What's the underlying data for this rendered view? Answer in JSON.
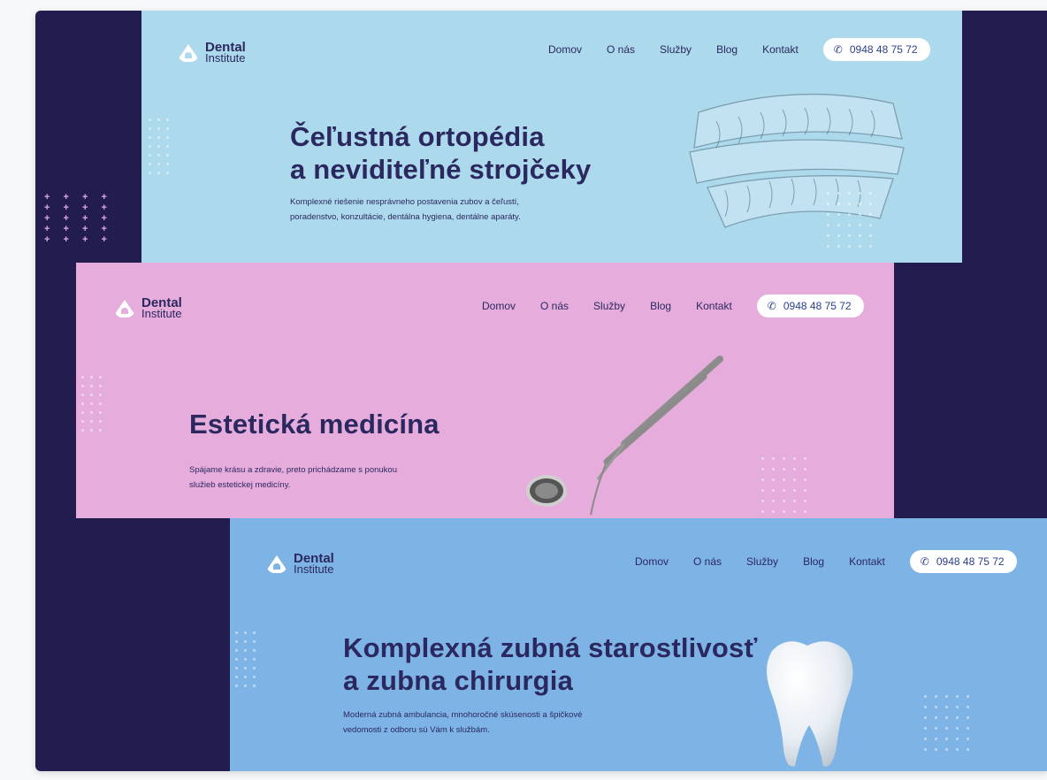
{
  "brand": {
    "name_line1": "Dental",
    "name_line2": "Institute"
  },
  "nav": [
    "Domov",
    "O nás",
    "Služby",
    "Blog",
    "Kontakt"
  ],
  "phone": "0948 48 75 72",
  "banners": [
    {
      "title_line1": "Čeľustná ortopédia",
      "title_line2": "a neviditeľné strojčeky",
      "desc_line1": "Komplexné riešenie nesprávneho postavenia zubov a čeľustí,",
      "desc_line2": "poradenstvo, konzultácie, dentálna hygiena, dentálne aparáty.",
      "bg": "#acd9eb"
    },
    {
      "title_line1": "Estetická medicína",
      "title_line2": "",
      "desc_line1": "Spájame krásu a zdravie, preto prichádzame s ponukou",
      "desc_line2": "služieb estetickej medicíny.",
      "bg": "#e6addc"
    },
    {
      "title_line1": "Komplexná zubná starostlivosť",
      "title_line2": "a zubna chirurgia",
      "desc_line1": "Moderná zubná ambulancia, mnohoročné skúsenosti a špičkové",
      "desc_line2": "vedomosti z odboru sú Vám k službám.",
      "bg": "#7eb3e5"
    }
  ],
  "colors": {
    "frame": "#231d4f",
    "text": "#2b2860",
    "phone_text": "#2b3f8f"
  },
  "icons": {
    "phone": "phone-icon",
    "logo": "tooth-logo-icon"
  }
}
